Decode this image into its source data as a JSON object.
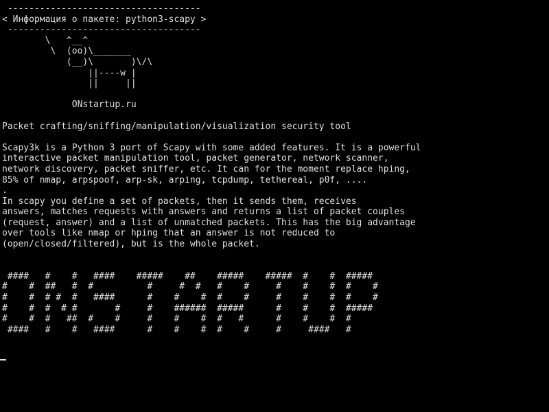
{
  "terminal": {
    "lines": [
      " ------------------------------------",
      "< Информация о пакете: python3-scapy >",
      " ------------------------------------",
      "        \\   ^__^",
      "         \\  (oo)\\_______",
      "            (__)\\       )\\/\\",
      "                ||----w |",
      "                ||     ||",
      "",
      "             ONstartup.ru",
      "",
      "Packet crafting/sniffing/manipulation/visualization security tool",
      "",
      "Scapy3k is a Python 3 port of Scapy with some added features. It is a powerful",
      "interactive packet manipulation tool, packet generator, network scanner,",
      "network discovery, packet sniffer, etc. It can for the moment replace hping,",
      "85% of nmap, arpspoof, arp-sk, arping, tcpdump, tethereal, p0f, ....",
      ".",
      "In scapy you define a set of packets, then it sends them, receives",
      "answers, matches requests with answers and returns a list of packet couples",
      "(request, answer) and a list of unmatched packets. This has the big advantage",
      "over tools like nmap or hping that an answer is not reduced to",
      "(open/closed/filtered), but is the whole packet.",
      "",
      "",
      " ####   #    #   ####    #####    ##    #####    #####  #    #  #####",
      "#    #  ##   #  #          #     #  #   #    #     #    #    #  #    #",
      "#    #  # #  #   ####      #    #    #  #    #     #    #    #  #    #",
      "#    #  #  # #       #     #    ######  #####      #    #    #  #####",
      "#    #  #   ##  #    #     #    #    #  #   #      #    #    #  #",
      " ####   #    #   ####      #    #    #  #    #     #     ####   #",
      ""
    ]
  }
}
